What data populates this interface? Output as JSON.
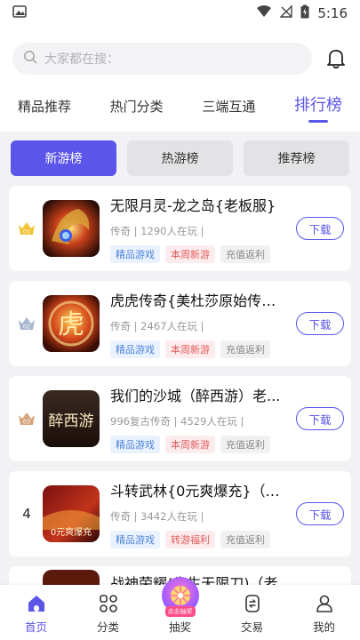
{
  "statusbar": {
    "time": "5:16"
  },
  "search": {
    "placeholder": "大家都在搜："
  },
  "tabs": [
    {
      "label": "精品推荐"
    },
    {
      "label": "热门分类"
    },
    {
      "label": "三端互通"
    },
    {
      "label": "排行榜"
    }
  ],
  "active_tab": "排行榜",
  "rank_tabs": [
    {
      "label": "新游榜"
    },
    {
      "label": "热游榜"
    },
    {
      "label": "推荐榜"
    }
  ],
  "games": [
    {
      "rank": "01",
      "name": "无限月灵-龙之岛{老板服}",
      "meta": "传奇 | 1290人在玩 |",
      "tags": [
        "精品游戏",
        "本周新游",
        "充值返利"
      ],
      "download": "下载"
    },
    {
      "rank": "02",
      "name": "虎虎传奇{美杜莎原始传奇...",
      "meta": "传奇 | 2467人在玩 |",
      "tags": [
        "精品游戏",
        "本周新游",
        "充值返利"
      ],
      "download": "下载"
    },
    {
      "rank": "03",
      "name": "我们的沙城（醉西游）老...",
      "meta": "996复古传奇 | 4529人在玩 |",
      "tags": [
        "精品游戏",
        "本周新游",
        "充值返利"
      ],
      "download": "下载"
    },
    {
      "rank": "4",
      "name": "斗转武林{0元爽爆充}（老...",
      "meta": "传奇 | 3442人在玩 |",
      "tags": [
        "精品游戏",
        "转游福利",
        "充值返利"
      ],
      "download": "下载"
    },
    {
      "rank": "",
      "name": "战神荣耀(先生无限刀)（老"
    }
  ],
  "thumbs": {
    "game1_text": "",
    "game2_text": "虎",
    "game3_text": "醉西游",
    "game4_text": "0元爽爆充"
  },
  "bottom_nav": [
    {
      "label": "首页"
    },
    {
      "label": "分类"
    },
    {
      "label": "抽奖",
      "badge": "点击抽奖"
    },
    {
      "label": "交易"
    },
    {
      "label": "我的"
    }
  ],
  "colors": {
    "accent": "#5b55e8",
    "tag_blue": "#4f84d8",
    "tag_red": "#e25b5b"
  }
}
